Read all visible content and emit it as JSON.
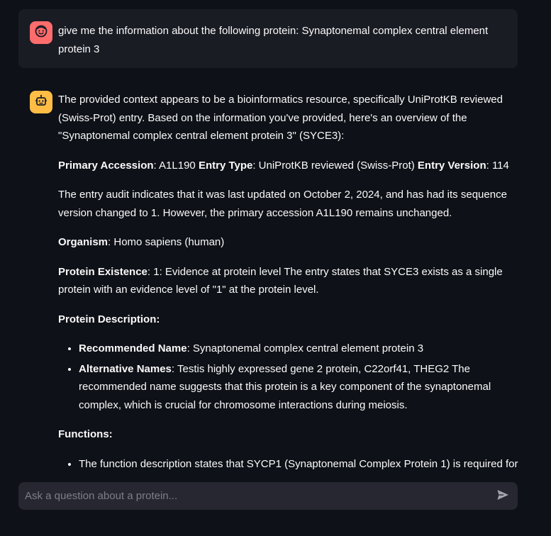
{
  "user_message": {
    "text": "give me the information about the following protein: Synaptonemal complex central element protein 3"
  },
  "assistant_message": {
    "intro": "The provided context appears to be a bioinformatics resource, specifically UniProtKB reviewed (Swiss-Prot) entry. Based on the information you've provided, here's an overview of the \"Synaptonemal complex central element protein 3\" (SYCE3):",
    "accession_label": "Primary Accession",
    "accession_value": ": A1L190 ",
    "entry_type_label": "Entry Type",
    "entry_type_value": ": UniProtKB reviewed (Swiss-Prot) ",
    "entry_version_label": "Entry Version",
    "entry_version_value": ": 114",
    "audit": "The entry audit indicates that it was last updated on October 2, 2024, and has had its sequence version changed to 1. However, the primary accession A1L190 remains unchanged.",
    "organism_label": "Organism",
    "organism_value": ": Homo sapiens (human)",
    "existence_label": "Protein Existence",
    "existence_value": ": 1: Evidence at protein level The entry states that SYCE3 exists as a single protein with an evidence level of \"1\" at the protein level.",
    "description_heading": "Protein Description:",
    "description_items": [
      {
        "label": "Recommended Name",
        "value": ": Synaptonemal complex central element protein 3"
      },
      {
        "label": "Alternative Names",
        "value": ": Testis highly expressed gene 2 protein, C22orf41, THEG2 The recommended name suggests that this protein is a key component of the synaptonemal complex, which is crucial for chromosome interactions during meiosis."
      }
    ],
    "functions_heading": "Functions:",
    "functions_items": [
      {
        "value": "The function description states that SYCP1 (Synaptonemal Complex Protein 1) is required for"
      }
    ]
  },
  "chat_input": {
    "placeholder": "Ask a question about a protein...",
    "value": ""
  },
  "icons": {
    "user_avatar": "face-icon",
    "assistant_avatar": "robot-icon",
    "send": "send-icon"
  },
  "colors": {
    "background": "#0e1117",
    "user_bubble": "#1a1c24",
    "user_avatar": "#ff6c6c",
    "assistant_avatar": "#ffbd45",
    "input_background": "#262730"
  }
}
